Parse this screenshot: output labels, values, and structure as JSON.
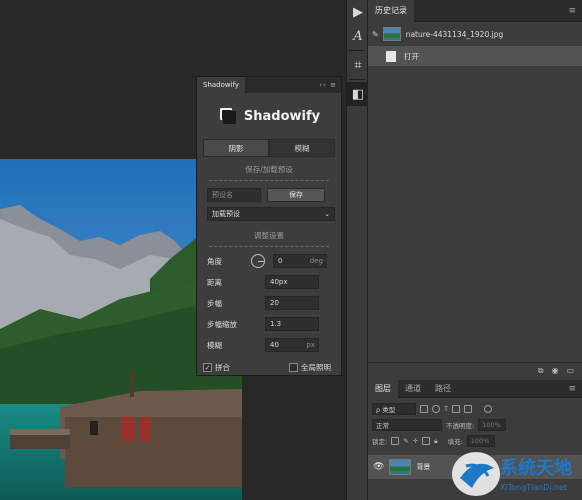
{
  "history_panel": {
    "tab_label": "历史记录",
    "snapshot_name": "nature-4431134_1920.jpg",
    "state_label": "打开"
  },
  "layers_panel": {
    "tabs": [
      "图层",
      "通道",
      "路径"
    ],
    "filter_kind": "ρ 类型",
    "blend_mode": "正常",
    "opacity_label": "不透明度:",
    "opacity_value": "100%",
    "lock_label": "锁定:",
    "fill_label": "填充:",
    "fill_value": "100%",
    "layer_name": "背景"
  },
  "shadowify": {
    "tab_label": "Shadowify",
    "title": "Shadowify",
    "mode_tabs": [
      "阴影",
      "模糊"
    ],
    "preset_section": "保存/加载预设",
    "preset_placeholder": "预设名",
    "save_button": "保存",
    "load_preset": "加载预设",
    "adjust_section": "调整设置",
    "fields": [
      {
        "label": "角度",
        "value": "0",
        "unit": "deg"
      },
      {
        "label": "距离",
        "value": "40px",
        "unit": ""
      },
      {
        "label": "步幅",
        "value": "20",
        "unit": ""
      },
      {
        "label": "步幅缩放",
        "value": "1.3",
        "unit": ""
      },
      {
        "label": "模糊",
        "value": "40",
        "unit": "px"
      }
    ],
    "checkbox_merge": "拼合",
    "checkbox_global_light": "全局照明"
  },
  "watermark": {
    "title": "系统天地",
    "url": "XiTongTianDi.net"
  },
  "colors": {
    "panel_bg": "#3c3c3c",
    "accent_highlight": "#535353",
    "watermark_blue": "#1e78c8"
  },
  "icons": [
    "play-icon",
    "text-path-icon",
    "crop-icon",
    "shadowify-icon",
    "brush-history-icon",
    "search-icon"
  ]
}
